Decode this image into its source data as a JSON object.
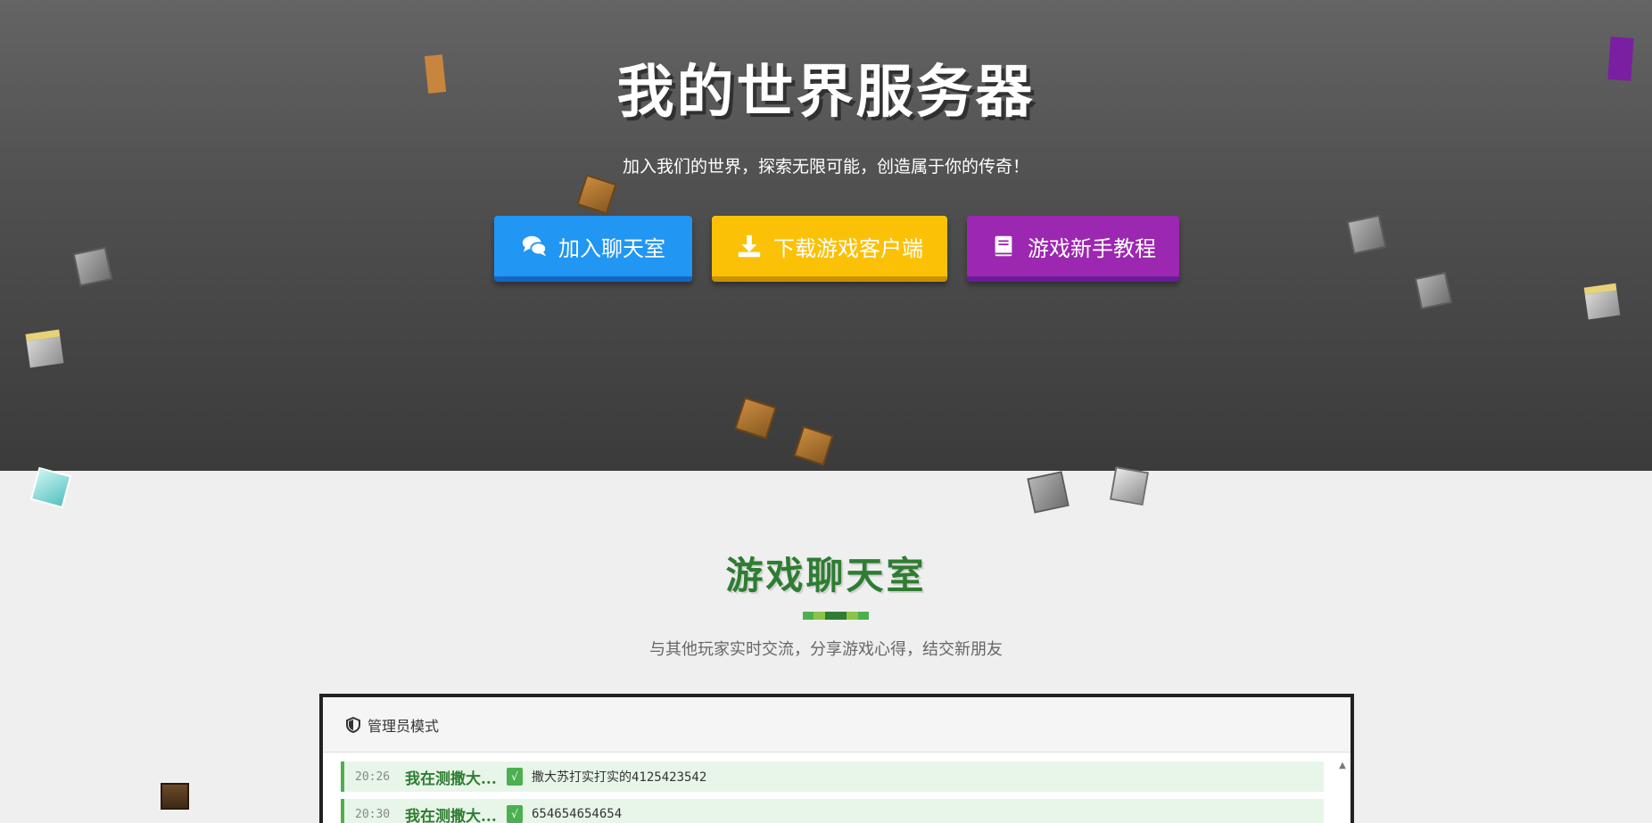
{
  "hero": {
    "title": "我的世界服务器",
    "subtitle": "加入我们的世界，探索无限可能，创造属于你的传奇！",
    "buttons": {
      "chat": {
        "label": "加入聊天室",
        "icon": "comments-icon",
        "color": "#2196f3"
      },
      "download": {
        "label": "下载游戏客户端",
        "icon": "download-icon",
        "color": "#fbc107"
      },
      "tutorial": {
        "label": "游戏新手教程",
        "icon": "book-icon",
        "color": "#9c27b0"
      }
    }
  },
  "chat_section": {
    "title": "游戏聊天室",
    "subtitle": "与其他玩家实时交流，分享游戏心得，结交新朋友",
    "accent_color": "#2e7d32",
    "divider_colors": [
      "#4caf50",
      "#8bc34a",
      "#2e7d32",
      "#2e7d32",
      "#8bc34a",
      "#4caf50"
    ]
  },
  "chat_panel": {
    "header": {
      "label": "管理员模式",
      "icon": "shield-icon"
    },
    "messages": [
      {
        "time": "20:26",
        "user": "我在测撒大...",
        "badge": "√",
        "text": "撒大苏打实打实的4125423542"
      },
      {
        "time": "20:30",
        "user": "我在测撒大...",
        "badge": "√",
        "text": "654654654654"
      }
    ]
  }
}
